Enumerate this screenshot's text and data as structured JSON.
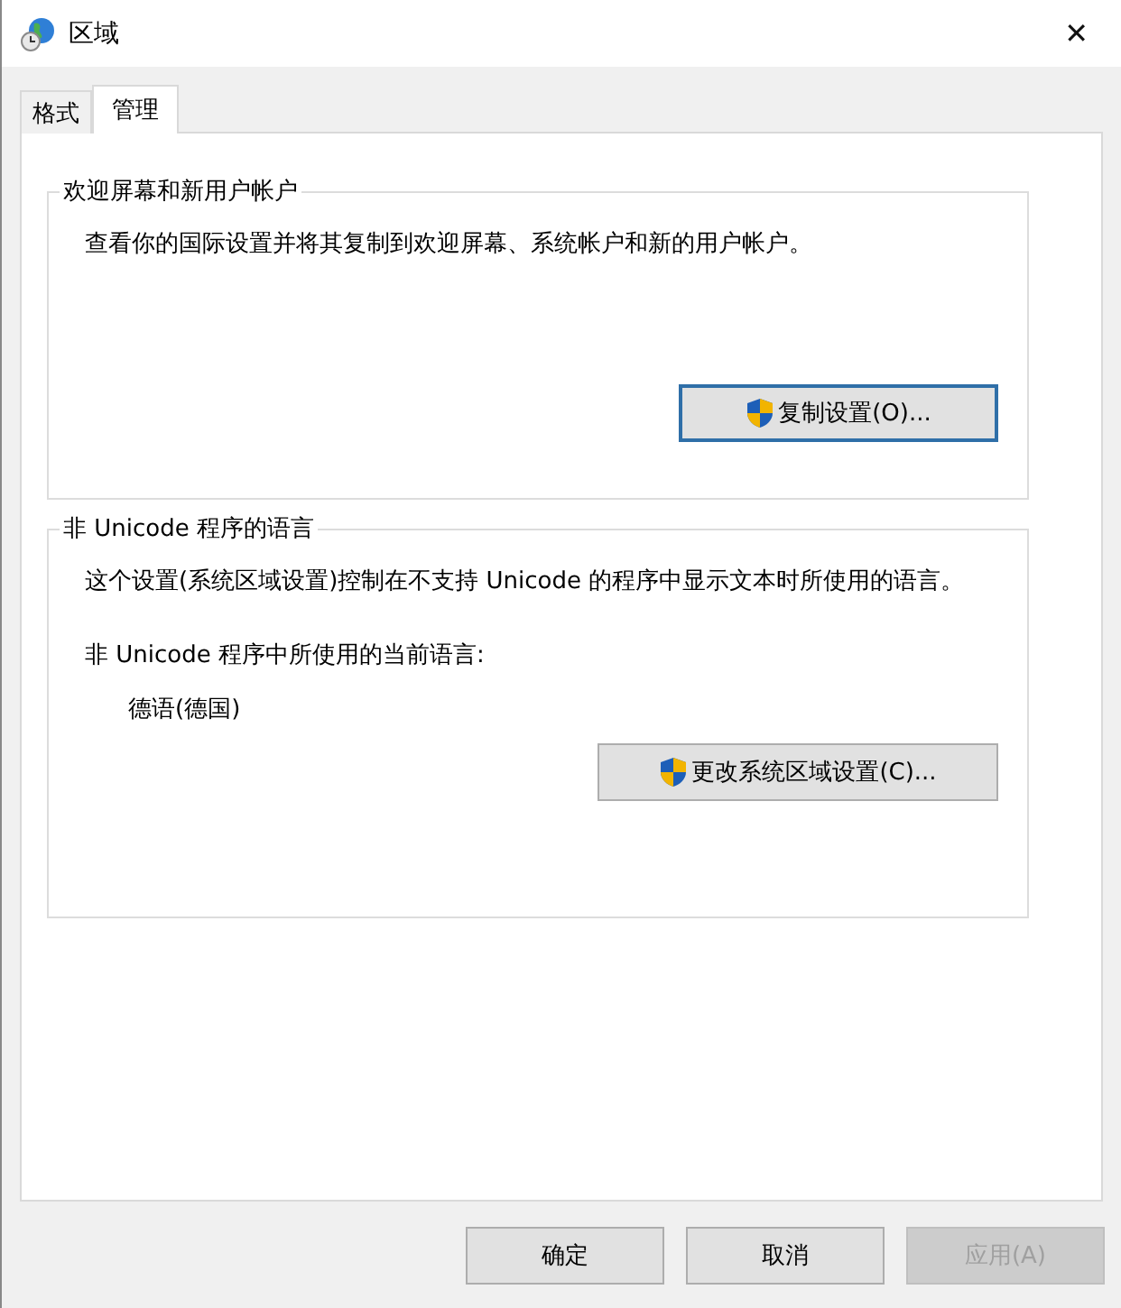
{
  "window": {
    "title": "区域",
    "close": "✕"
  },
  "tabs": [
    {
      "label": "格式",
      "selected": false
    },
    {
      "label": "管理",
      "selected": true
    }
  ],
  "groups": [
    {
      "title": "欢迎屏幕和新用户帐户",
      "description": "查看你的国际设置并将其复制到欢迎屏幕、系统帐户和新的用户帐户。",
      "button": {
        "label": "复制设置(O)...",
        "focused": true
      }
    },
    {
      "title": "非 Unicode 程序的语言",
      "description": "这个设置(系统区域设置)控制在不支持 Unicode 的程序中显示文本时所使用的语言。",
      "current_label": "非 Unicode 程序中所使用的当前语言:",
      "current_value": "德语(德国)",
      "button": {
        "label": "更改系统区域设置(C)...",
        "focused": false
      }
    }
  ],
  "buttons": [
    {
      "label": "确定",
      "disabled": false
    },
    {
      "label": "取消",
      "disabled": false
    },
    {
      "label": "应用(A)",
      "disabled": true
    }
  ]
}
